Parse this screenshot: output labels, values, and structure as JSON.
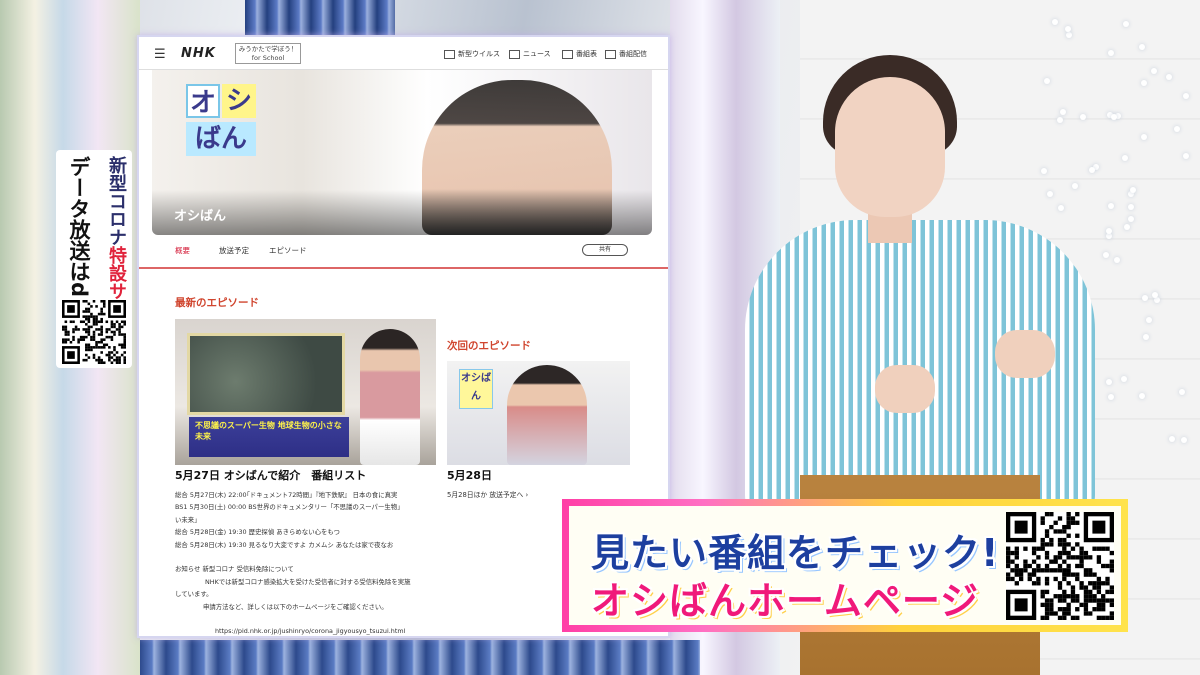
{
  "left_banner": {
    "covid_prefix": "新型コロナ",
    "covid_highlight": "特設サイト",
    "datacast": "データ放送はd"
  },
  "web": {
    "brand": "NHK",
    "menu_icon": "hamburger-icon",
    "school_box": "みうかたで学ぼう！ for School",
    "header_links": [
      "新型ウイルス",
      "ニュース",
      "番組表",
      "番組配信"
    ],
    "hero_title": "オシばん",
    "logo_chars": [
      "オ",
      "シ",
      "ばん"
    ],
    "tabs": [
      "概要",
      "放送予定",
      "エピソード"
    ],
    "share_label": "共有",
    "latest_heading": "最新のエピソード",
    "next_heading": "次回のエピソード",
    "latest_caption": "不思議のスーパー生物 地球生物の小さな未来",
    "latest_title": "5月27日 オシばんで紹介　番組リスト",
    "next_logo": "オシばん",
    "next_title": "5月28日",
    "next_link": "5月28日ほか 放送予定へ ›",
    "body_lines": [
      "総合 5月27日(木) 22:00｢ドキュメント72時間｣『地下鉄駅』 日本の食に真実",
      "BS1 5月30日(土) 00:00 BS世界のドキュメンタリー「不思議のスーパー生物」",
      "い未来」",
      "総合 5月28日(金) 19:30 歴史探偵 あきらめない心をもつ",
      "総合 5月28日(木) 19:30 見るなり大変ですよ カメムシ あなたは家で夜なお",
      "",
      "お知らせ 新型コロナ 受信料免除について",
      "NHKでは新型コロナ感染拡大を受けた受信者に対する受信料免除を実施",
      "しています。",
      "申請方法など、詳しくは以下のホームページをご確認ください。",
      "",
      "https://pid.nhk.or.jp/jushinryo/corona_jigyousyo_tsuzui.html"
    ]
  },
  "promo": {
    "line1": "見たい番組をチェック!",
    "line2": "オシばんホームページ"
  },
  "colors": {
    "accent_red": "#d41e3a",
    "promo_blue": "#1d3f9f",
    "promo_pink": "#f0197a"
  }
}
